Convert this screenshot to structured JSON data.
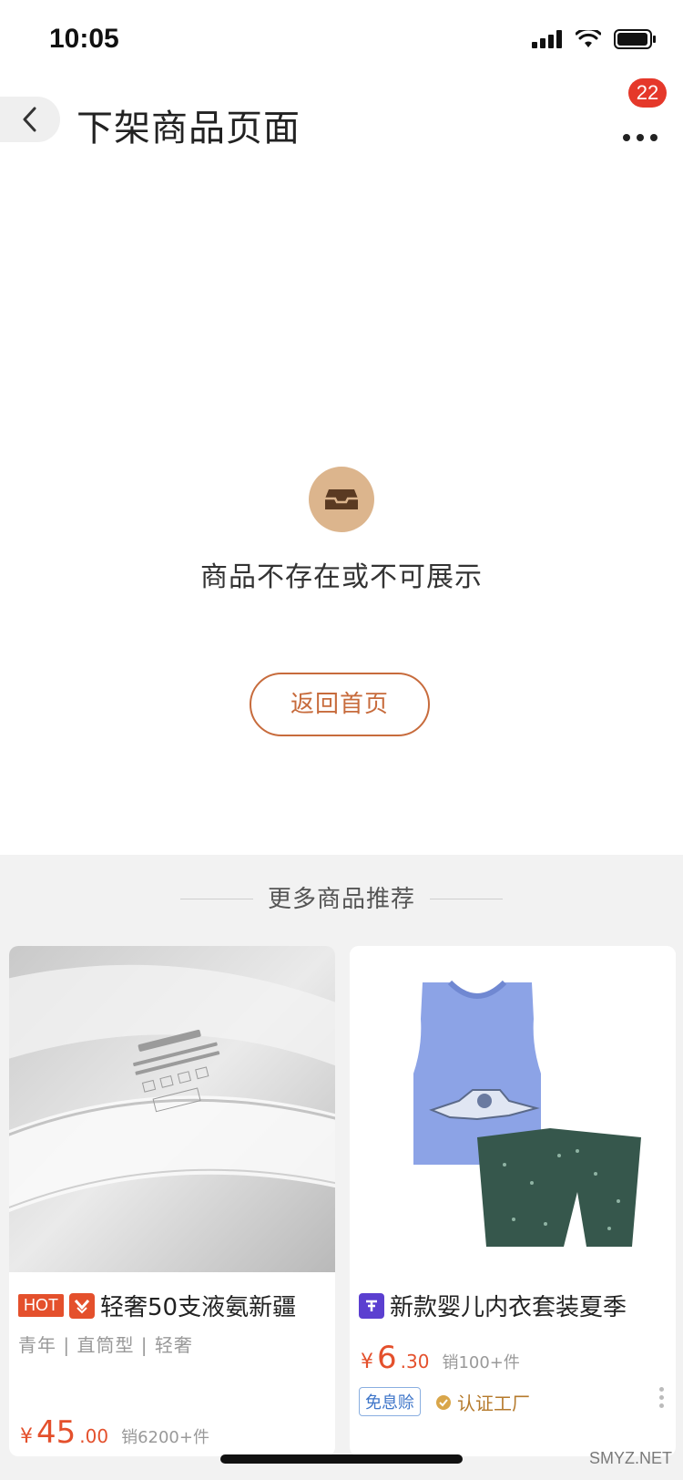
{
  "status_bar": {
    "time": "10:05"
  },
  "nav": {
    "title": "下架商品页面",
    "badge_count": "22"
  },
  "empty_state": {
    "message": "商品不存在或不可展示",
    "button": "返回首页",
    "icon": "inbox-icon",
    "icon_color": "#dcb58d"
  },
  "recommend": {
    "title": "更多商品推荐",
    "items": [
      {
        "hot_tag": "HOT",
        "title": "轻奢50支液氨新疆",
        "subtitle": "青年 | 直筒型 | 轻奢",
        "price_symbol": "¥",
        "price_int": "45",
        "price_dec": ".00",
        "sales": "销6200+件",
        "image": "white-tshirt-collar"
      },
      {
        "title": "新款婴儿内衣套装夏季",
        "price_symbol": "¥",
        "price_int": "6",
        "price_dec": ".30",
        "sales": "销100+件",
        "badge": "免息赊",
        "factory": "认证工厂",
        "image": "baby-vest-shorts-set"
      }
    ]
  },
  "watermark": "SMYZ.NET",
  "colors": {
    "accent": "#e4502c",
    "button_border": "#c76b3c",
    "badge": "#e5382a"
  }
}
